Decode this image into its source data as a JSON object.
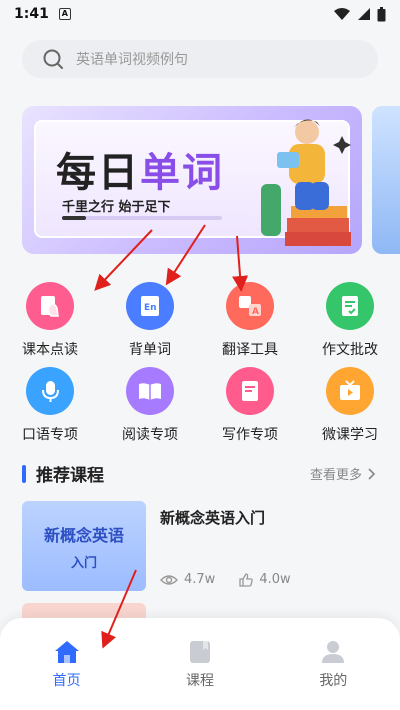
{
  "status": {
    "time": "1:41",
    "sim_label": "A"
  },
  "search": {
    "placeholder": "英语单词视频例句"
  },
  "banner": {
    "title_plain": "每日",
    "title_highlight": "单词",
    "subtitle": "千里之行 始于足下"
  },
  "grid": {
    "row1": [
      {
        "label": "课本点读",
        "icon": "book-hand-icon",
        "color": "#ff5d8f"
      },
      {
        "label": "背单词",
        "icon": "en-book-icon",
        "color": "#4a7dff"
      },
      {
        "label": "翻译工具",
        "icon": "translate-icon",
        "color": "#ff6a5c"
      },
      {
        "label": "作文批改",
        "icon": "document-check-icon",
        "color": "#35c56a"
      }
    ],
    "row2": [
      {
        "label": "口语专项",
        "icon": "microphone-icon",
        "color": "#3aa2ff"
      },
      {
        "label": "阅读专项",
        "icon": "open-book-icon",
        "color": "#a77bff"
      },
      {
        "label": "写作专项",
        "icon": "document-icon",
        "color": "#ff5b8c"
      },
      {
        "label": "微课学习",
        "icon": "tv-icon",
        "color": "#ffa531"
      }
    ]
  },
  "section": {
    "title": "推荐课程",
    "see_more": "查看更多"
  },
  "course": {
    "thumb_line1": "新概念英语",
    "thumb_line2": "入门",
    "name": "新概念英语入门",
    "views": "4.7w",
    "likes": "4.0w"
  },
  "tabs": [
    {
      "label": "首页",
      "icon": "home-icon",
      "active": true
    },
    {
      "label": "课程",
      "icon": "course-book-icon",
      "active": false
    },
    {
      "label": "我的",
      "icon": "user-icon",
      "active": false
    }
  ],
  "colors": {
    "accent": "#2f6bff",
    "annotation_arrow": "#e0201c"
  }
}
